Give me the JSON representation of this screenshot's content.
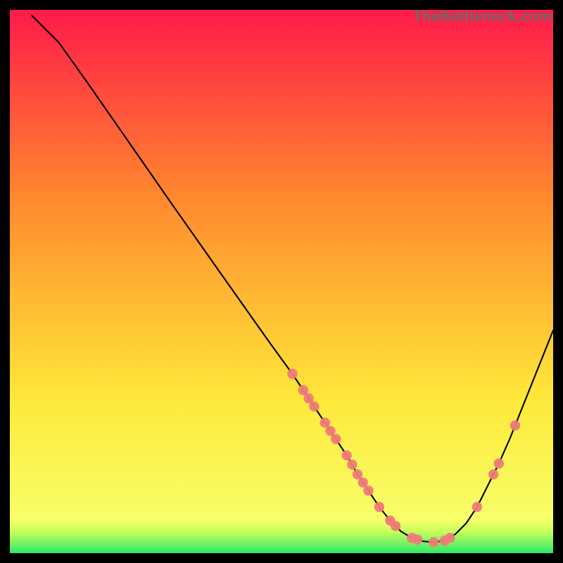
{
  "watermark": "TheBottleneck.com",
  "chart_data": {
    "type": "line",
    "title": "",
    "xlabel": "",
    "ylabel": "",
    "xlim": [
      0,
      100
    ],
    "ylim": [
      0,
      100
    ],
    "grid": false,
    "legend": false,
    "background_gradient": {
      "top": "#ff1a4a",
      "mid1": "#ff8a2e",
      "mid2": "#ffe93a",
      "bottom_band": "#2ee86a"
    },
    "curve": [
      {
        "x": 4.0,
        "y": 99.0
      },
      {
        "x": 9.0,
        "y": 94.0
      },
      {
        "x": 14.0,
        "y": 87.0
      },
      {
        "x": 22.0,
        "y": 75.5
      },
      {
        "x": 30.0,
        "y": 64.0
      },
      {
        "x": 40.0,
        "y": 49.8
      },
      {
        "x": 48.0,
        "y": 38.5
      },
      {
        "x": 52.0,
        "y": 33.0
      },
      {
        "x": 55.0,
        "y": 28.5
      },
      {
        "x": 58.0,
        "y": 24.0
      },
      {
        "x": 60.0,
        "y": 21.0
      },
      {
        "x": 62.0,
        "y": 18.0
      },
      {
        "x": 64.0,
        "y": 14.5
      },
      {
        "x": 66.0,
        "y": 11.5
      },
      {
        "x": 68.0,
        "y": 8.5
      },
      {
        "x": 70.0,
        "y": 6.0
      },
      {
        "x": 72.0,
        "y": 4.0
      },
      {
        "x": 74.0,
        "y": 2.8
      },
      {
        "x": 76.0,
        "y": 2.2
      },
      {
        "x": 78.0,
        "y": 2.0
      },
      {
        "x": 80.0,
        "y": 2.3
      },
      {
        "x": 82.0,
        "y": 3.5
      },
      {
        "x": 84.0,
        "y": 5.5
      },
      {
        "x": 86.0,
        "y": 8.5
      },
      {
        "x": 88.0,
        "y": 12.5
      },
      {
        "x": 90.0,
        "y": 16.5
      },
      {
        "x": 92.0,
        "y": 21.0
      },
      {
        "x": 95.0,
        "y": 28.5
      },
      {
        "x": 98.0,
        "y": 36.0
      },
      {
        "x": 100.0,
        "y": 41.0
      }
    ],
    "markers": [
      {
        "x": 52.0,
        "y": 33.0
      },
      {
        "x": 54.0,
        "y": 30.0
      },
      {
        "x": 55.0,
        "y": 28.5
      },
      {
        "x": 56.0,
        "y": 27.0
      },
      {
        "x": 58.0,
        "y": 24.0
      },
      {
        "x": 59.0,
        "y": 22.5
      },
      {
        "x": 60.0,
        "y": 21.0
      },
      {
        "x": 62.0,
        "y": 18.0
      },
      {
        "x": 63.0,
        "y": 16.3
      },
      {
        "x": 64.0,
        "y": 14.5
      },
      {
        "x": 65.0,
        "y": 13.0
      },
      {
        "x": 66.0,
        "y": 11.5
      },
      {
        "x": 68.0,
        "y": 8.5
      },
      {
        "x": 70.0,
        "y": 6.0
      },
      {
        "x": 71.0,
        "y": 5.0
      },
      {
        "x": 74.0,
        "y": 2.8
      },
      {
        "x": 75.0,
        "y": 2.5
      },
      {
        "x": 78.0,
        "y": 2.0
      },
      {
        "x": 80.0,
        "y": 2.3
      },
      {
        "x": 81.0,
        "y": 2.8
      },
      {
        "x": 86.0,
        "y": 8.5
      },
      {
        "x": 89.0,
        "y": 14.5
      },
      {
        "x": 90.0,
        "y": 16.5
      },
      {
        "x": 93.0,
        "y": 23.5
      }
    ],
    "marker_color": "#f07a7a",
    "curve_color": "#000000"
  }
}
